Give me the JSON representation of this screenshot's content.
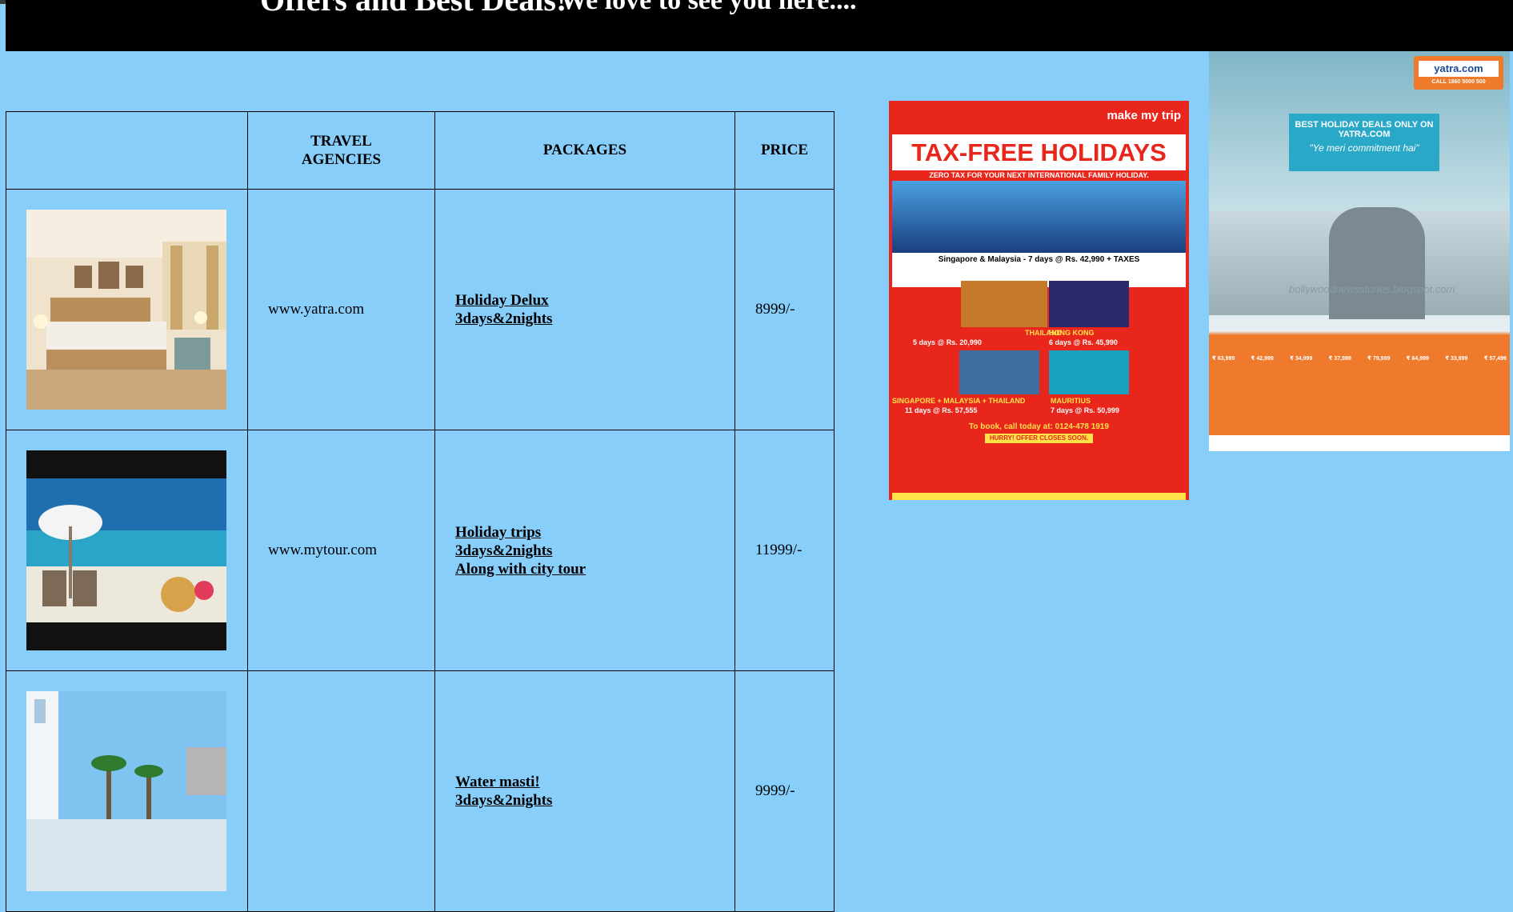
{
  "banner": {
    "title": "Offers and Best Deals!",
    "subtitle": "We love to see you here...."
  },
  "table": {
    "headers": [
      "",
      "TRAVEL AGENCIES",
      "PACKAGES",
      "PRICE"
    ],
    "rows": [
      {
        "image": "hotel-room-image",
        "agency": "www.yatra.com",
        "package_lines": [
          "Holiday Delux",
          "3days&2nights"
        ],
        "price": "8999/-"
      },
      {
        "image": "beach-umbrella-image",
        "agency": "www.mytour.com",
        "package_lines": [
          "Holiday trips",
          "3days&2nights",
          "Along with city tour"
        ],
        "price": "11999/-"
      },
      {
        "image": "resort-palm-image",
        "agency": "",
        "package_lines": [
          "Water masti!",
          "3days&2nights"
        ],
        "price": "9999/-"
      }
    ]
  },
  "ads": {
    "makemytrip": {
      "brand": "make my trip",
      "headline": "TAX-FREE HOLIDAYS",
      "tagline": "ZERO TAX FOR YOUR NEXT INTERNATIONAL FAMILY HOLIDAY.",
      "offer_main": "Singapore & Malaysia - 7 days @ Rs. 42,990 + TAXES",
      "deals": [
        "THAILAND",
        "HONG KONG",
        "SINGAPORE + MALAYSIA + THAILAND",
        "MAURITIUS"
      ],
      "deal_prices": [
        "5 days @ Rs. 20,990",
        "6 days @ Rs. 45,990",
        "11 days @ Rs. 57,555",
        "7 days @ Rs. 50,999"
      ],
      "call": "To book, call today at: 0124-478 1919",
      "hurry": "HURRY! OFFER CLOSES SOON."
    },
    "yatra": {
      "brand": "yatra.com",
      "call": "CALL 1860 5000 500",
      "headline": "BEST HOLIDAY DEALS ONLY ON YATRA.COM",
      "quote": "\"Ye meri commitment hai\"",
      "watermark": "bollywoodnewsstories.blogspot.com",
      "prices": [
        "₹ 63,999",
        "₹ 42,999",
        "₹ 34,999",
        "₹ 37,999",
        "₹ 79,999",
        "₹ 64,999",
        "₹ 33,999",
        "₹ 57,499"
      ]
    }
  }
}
